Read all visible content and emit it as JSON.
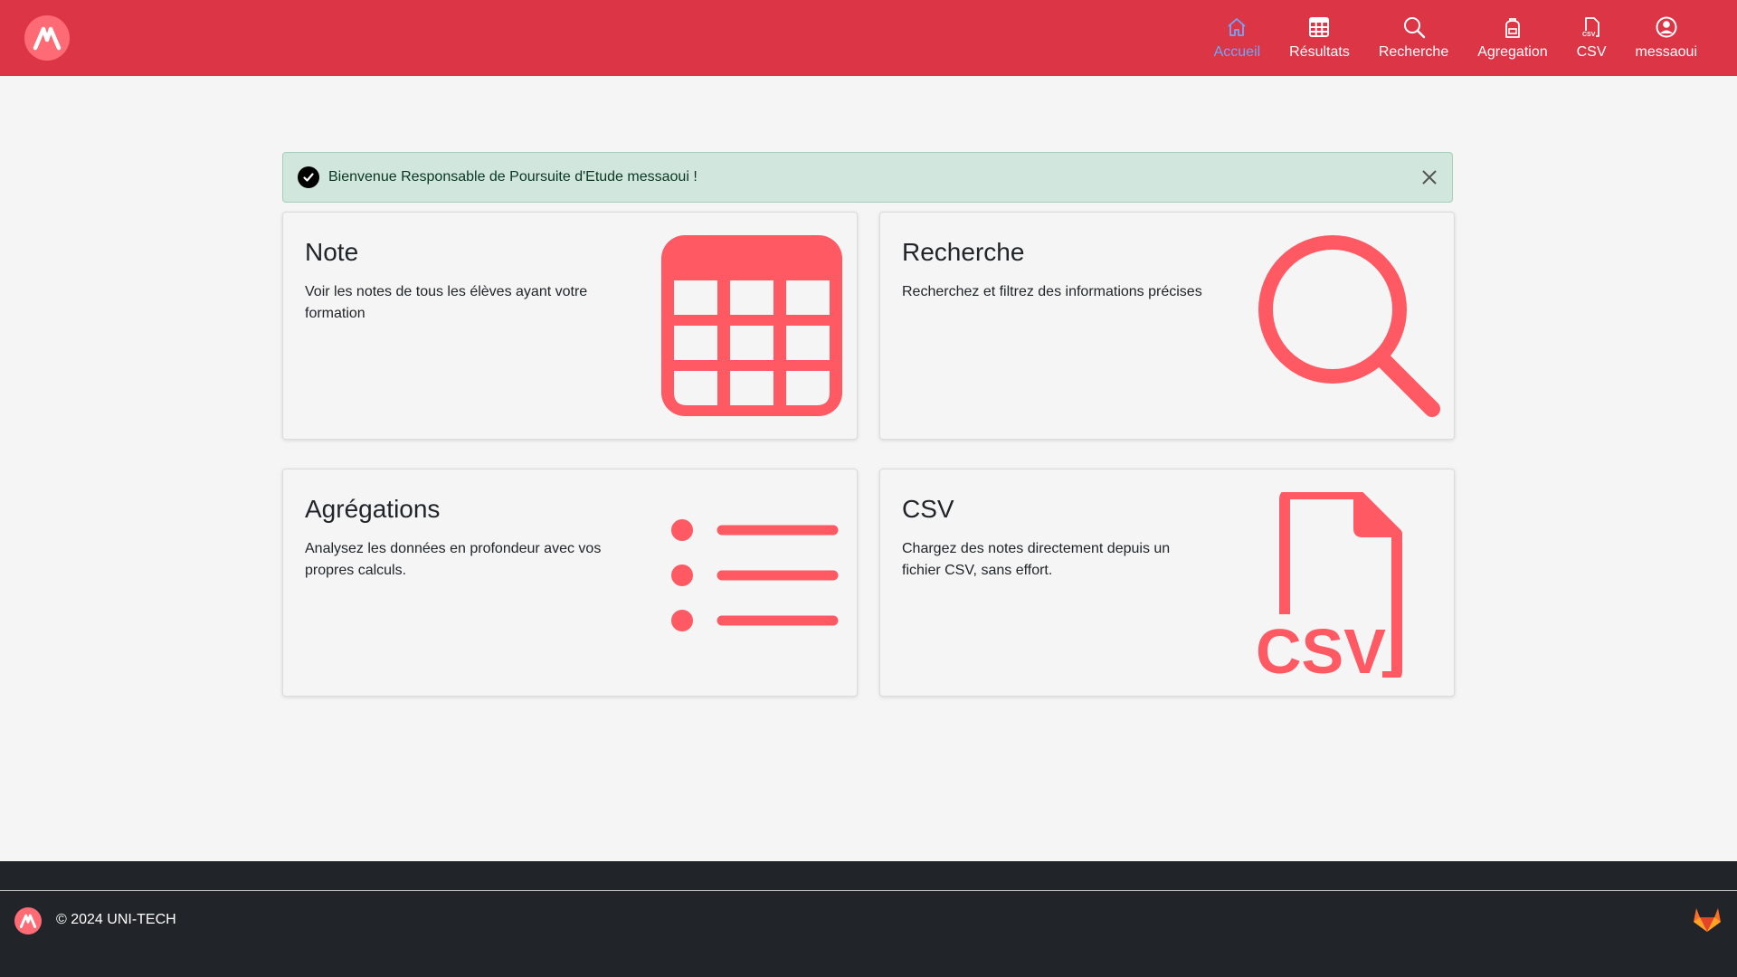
{
  "brand": {
    "logo_icon": "university-m-logo"
  },
  "nav": {
    "items": [
      {
        "label": "Accueil",
        "icon": "home-icon",
        "active": true
      },
      {
        "label": "Résultats",
        "icon": "table-icon"
      },
      {
        "label": "Recherche",
        "icon": "search-icon"
      },
      {
        "label": "Agregation",
        "icon": "backpack-icon"
      },
      {
        "label": "CSV",
        "icon": "csv-file-icon"
      },
      {
        "label": "messaoui",
        "icon": "user-circle-icon"
      }
    ]
  },
  "alert": {
    "message": "Bienvenue Responsable de Poursuite d'Etude messaoui !",
    "type": "success"
  },
  "cards": [
    {
      "title": "Note",
      "text": "Voir les notes de tous les élèves ayant votre formation",
      "icon": "table-icon"
    },
    {
      "title": "Recherche",
      "text": "Recherchez et filtrez des informations précises",
      "icon": "search-icon"
    },
    {
      "title": "Agrégations",
      "text": "Analysez les données en profondeur avec vos propres calculs.",
      "icon": "list-icon"
    },
    {
      "title": "CSV",
      "text": "Chargez des notes directement depuis un fichier CSV, sans effort.",
      "icon": "csv-file-icon",
      "icon_text": "CSV"
    }
  ],
  "footer": {
    "copyright": "© 2024 UNI-TECH",
    "gitlab_icon": "gitlab-icon"
  },
  "colors": {
    "navbar": "#dc3545",
    "accent": "#ff5964",
    "active": "#6ea8fe",
    "footer": "#212529",
    "alert_bg": "#d1e7dd"
  }
}
